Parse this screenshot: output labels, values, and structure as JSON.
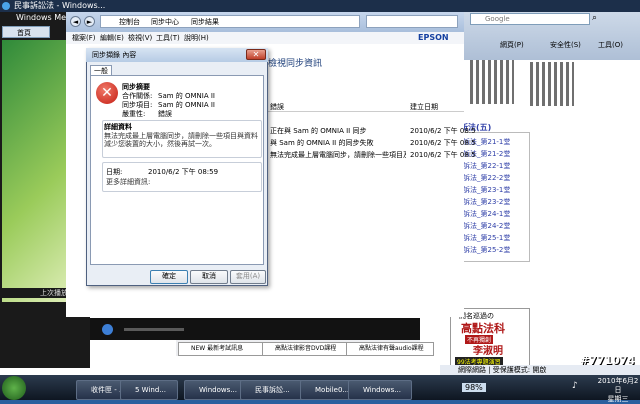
{
  "browser": {
    "title": "民事訴訟法 - Windows...",
    "search_placeholder": "Google",
    "right_toolbar": {
      "favorites": "網頁(P)",
      "safety": "安全性(S)",
      "tools": "工具(O)"
    },
    "status_zone": "網際網路 | 受保護模式: 開啟"
  },
  "media_player": {
    "title": "Windows Media Player",
    "tab_label": "首頁",
    "status_text": "上次播放..."
  },
  "sync_center": {
    "breadcrumb": [
      "控制台",
      "同步中心",
      "同步結果"
    ],
    "menu": [
      "檔案(F)",
      "編輯(E)",
      "檢視(V)",
      "工具(T)",
      "說明(H)"
    ],
    "heading": "檢視同步資訊",
    "brand": "EPSON",
    "col_error": "錯誤",
    "col_date": "建立日期",
    "rows": [
      {
        "text": "正在與 Sam 的 OMNIA II 同步",
        "date": "2010/6/2 下午 08:5"
      },
      {
        "text": "與 Sam 的 OMNIA II 的同步失敗",
        "date": "2010/6/2 下午 08:5"
      },
      {
        "text": "無法完成最上層電腦同步，請刪除一些項目及資料...",
        "date": "2010/6/2 下午 08:5"
      }
    ]
  },
  "dialog": {
    "title": "同步擷錄 內容",
    "tab": "一般",
    "summary_title": "同步摘要",
    "partner_label": "合作關係:",
    "partner_value": "Sam 的 OMNIA II",
    "item_label": "同步項目:",
    "item_value": "Sam 的 OMNIA II",
    "severity_label": "嚴重性:",
    "severity_value": "錯誤",
    "details_title": "詳細資料",
    "details_text1": "無法完成最上層電腦同步，請刪除一些項目與資料以便",
    "details_text2": "減少您裝置的大小，然後再試一次。",
    "date_label": "日期:",
    "date_value": "2010/6/2 下午 08:59",
    "more_info": "更多詳細資訊:",
    "ok": "確定",
    "cancel": "取消",
    "apply": "套用(A)"
  },
  "law_links": {
    "header": "新法(五)",
    "items": [
      "訴法_第21-1堂",
      "訴法_第21-2堂",
      "訴法_第22-1堂",
      "訴法_第22-2堂",
      "訴法_第23-1堂",
      "訴法_第23-2堂",
      "訴法_第24-1堂",
      "訴法_第24-2堂",
      "訴法_第25-1堂",
      "訴法_第25-2堂"
    ]
  },
  "law_ad": {
    "line1": "開名巡過の",
    "line2": "高點法科",
    "line3": "不再獨創",
    "line4": "李淑明",
    "line5": "99法考專題演習"
  },
  "lower_buttons": [
    "NEW 最新考試訊息",
    "高點法律影音DVD課程",
    "高點法律有聲audio課程"
  ],
  "taskbar": {
    "tasks": [
      "收件匣 - ...",
      "5 Wind...",
      "Windows...",
      "民事訴訟...",
      "Mobile0...",
      "Windows..."
    ],
    "zoom": "98%",
    "clock_time": "2010年6月2日",
    "clock_day": "星期三"
  },
  "watermark": "#771074",
  "colors": {
    "accent": "#3d7fd6",
    "error": "#c41c12",
    "link": "#3040a8"
  }
}
